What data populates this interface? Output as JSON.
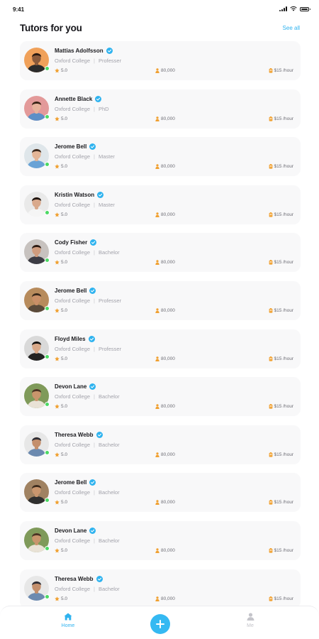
{
  "status_bar": {
    "time": "9:41"
  },
  "header": {
    "title": "Tutors for you",
    "see_all": "See all"
  },
  "tutors": [
    {
      "name": "Mattias Adolfsson",
      "college": "Oxford College",
      "degree": "Professer",
      "rating": "5.0",
      "students": "80,000",
      "price": "$15 /hour",
      "avatar": {
        "bg": "#f0a15a",
        "skin": "#8a5a3b",
        "hair": "#2a1a12",
        "shirt": "#2b2b2b"
      }
    },
    {
      "name": "Annette Black",
      "college": "Oxford College",
      "degree": "PhD",
      "rating": "5.0",
      "students": "80,000",
      "price": "$15 /hour",
      "avatar": {
        "bg": "#e39a9a",
        "skin": "#e8b39c",
        "hair": "#3a2417",
        "shirt": "#5d8fc7"
      }
    },
    {
      "name": "Jerome Bell",
      "college": "Oxford College",
      "degree": "Master",
      "rating": "5.0",
      "students": "80,000",
      "price": "$15 /hour",
      "avatar": {
        "bg": "#dfe6ea",
        "skin": "#e3b597",
        "hair": "#3d2a1e",
        "shirt": "#6aa3d6"
      }
    },
    {
      "name": "Kristin Watson",
      "college": "Oxford College",
      "degree": "Master",
      "rating": "5.0",
      "students": "80,000",
      "price": "$15 /hour",
      "avatar": {
        "bg": "#e9e9e9",
        "skin": "#d9a98c",
        "hair": "#1e1410",
        "shirt": "#f5f5f5"
      }
    },
    {
      "name": "Cody Fisher",
      "college": "Oxford College",
      "degree": "Bachelor",
      "rating": "5.0",
      "students": "80,000",
      "price": "$15 /hour",
      "avatar": {
        "bg": "#c7c2bf",
        "skin": "#cf9c7e",
        "hair": "#2b1b14",
        "shirt": "#3c3c44"
      }
    },
    {
      "name": "Jerome Bell",
      "college": "Oxford College",
      "degree": "Professer",
      "rating": "5.0",
      "students": "80,000",
      "price": "$15 /hour",
      "avatar": {
        "bg": "#b78b5c",
        "skin": "#c98f67",
        "hair": "#3a2a1c",
        "shirt": "#5a4a3a"
      }
    },
    {
      "name": "Floyd Miles",
      "college": "Oxford College",
      "degree": "Professer",
      "rating": "5.0",
      "students": "80,000",
      "price": "$15 /hour",
      "avatar": {
        "bg": "#d9d9d9",
        "skin": "#d8a888",
        "hair": "#111111",
        "shirt": "#222222"
      }
    },
    {
      "name": "Devon Lane",
      "college": "Oxford College",
      "degree": "Bachelor",
      "rating": "5.0",
      "students": "80,000",
      "price": "$15 /hour",
      "avatar": {
        "bg": "#7f9a5a",
        "skin": "#c8956c",
        "hair": "#4a3424",
        "shirt": "#e9e2d6"
      }
    },
    {
      "name": "Theresa Webb",
      "college": "Oxford College",
      "degree": "Bachelor",
      "rating": "5.0",
      "students": "80,000",
      "price": "$15 /hour",
      "avatar": {
        "bg": "#e7e7e7",
        "skin": "#c48f6c",
        "hair": "#2e2e36",
        "shirt": "#6c8ab0"
      }
    },
    {
      "name": "Jerome Bell",
      "college": "Oxford College",
      "degree": "Bachelor",
      "rating": "5.0",
      "students": "80,000",
      "price": "$15 /hour",
      "avatar": {
        "bg": "#a08262",
        "skin": "#c9966e",
        "hair": "#3b2a1c",
        "shirt": "#2f2f2f"
      }
    },
    {
      "name": "Devon Lane",
      "college": "Oxford College",
      "degree": "Bachelor",
      "rating": "5.0",
      "students": "80,000",
      "price": "$15 /hour",
      "avatar": {
        "bg": "#7f9a5a",
        "skin": "#c8956c",
        "hair": "#4a3424",
        "shirt": "#e9e2d6"
      }
    },
    {
      "name": "Theresa Webb",
      "college": "Oxford College",
      "degree": "Bachelor",
      "rating": "5.0",
      "students": "80,000",
      "price": "$15 /hour",
      "avatar": {
        "bg": "#e7e7e7",
        "skin": "#c48f6c",
        "hair": "#2e2e36",
        "shirt": "#6c8ab0"
      }
    }
  ],
  "icons": {
    "verified": "verified-check-icon",
    "rating": "star-icon",
    "students": "person-icon",
    "price": "price-tag-icon"
  },
  "colors": {
    "accent": "#2fb3ef",
    "verified": "#2fb3ef",
    "online": "#4cd964",
    "star": "#f0a132"
  },
  "bottom_nav": {
    "home_label": "Home",
    "me_label": "Me",
    "active": "Home"
  }
}
